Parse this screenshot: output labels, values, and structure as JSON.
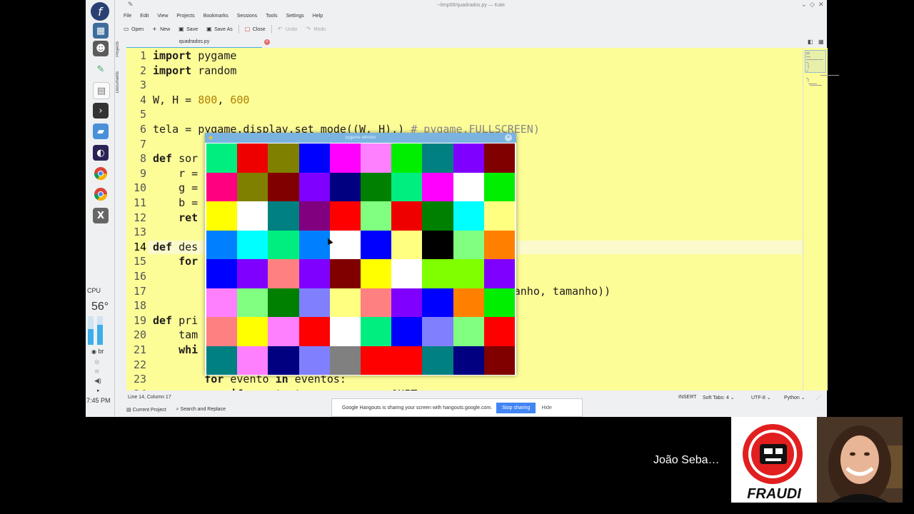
{
  "panel": {
    "fedora_glyph": "f",
    "cpu_label": "CPU",
    "cpu_temp": "56°",
    "keyboard_layout": "br",
    "clock": "7:45 PM",
    "dock_icons": [
      "fedora-icon",
      "console-icon",
      "gimp-icon",
      "document-icon",
      "terminal-icon",
      "chat-icon",
      "eclipse-icon",
      "chrome-icon",
      "chrome-icon",
      "xournal-icon"
    ]
  },
  "kate": {
    "window_title": "~/tmp06/quadrados.py — Kate",
    "menu": [
      "File",
      "Edit",
      "View",
      "Projects",
      "Bookmarks",
      "Sessions",
      "Tools",
      "Settings",
      "Help"
    ],
    "toolbar": {
      "open": "Open",
      "new": "New",
      "save": "Save",
      "save_as": "Save As",
      "close": "Close",
      "undo": "Undo",
      "redo": "Redo"
    },
    "tab_name": "quadrados.py",
    "sidebar_tabs": [
      "Projects",
      "Documents"
    ],
    "code_lines": [
      "import pygame",
      "import random",
      "",
      "W, H = 800, 600",
      "",
      "tela = pygame.display.set_mode((W, H),) # pygame.FULLSCREEN)",
      "",
      "def sor",
      "    r =",
      "    g =",
      "    b =",
      "    ret",
      "",
      "def des",
      "    for",
      "",
      "                                                  y, tamanho, tamanho))",
      "",
      "def pri",
      "    tam",
      "    whi",
      "",
      "        for evento in eventos:",
      "            if evento.type == pygame.QUIT:"
    ],
    "status": {
      "position": "Line 14, Column 17",
      "mode": "INSERT",
      "indent": "Soft Tabs: 4",
      "encoding": "UTF-8",
      "language": "Python"
    },
    "bottom_tabs": [
      "Current Project",
      "Search and Replace"
    ]
  },
  "pygame": {
    "title": "pygame window",
    "colors": [
      "#00ee80",
      "#ee0000",
      "#808000",
      "#0000ff",
      "#ff00ff",
      "#ff80ff",
      "#00ee00",
      "#008080",
      "#8000ff",
      "#800000",
      "#ff0080",
      "#808000",
      "#800000",
      "#8000ff",
      "#000080",
      "#008000",
      "#00ee80",
      "#ff00ff",
      "#ffffff",
      "#00ee00",
      "#ffff00",
      "#ffffff",
      "#008080",
      "#800080",
      "#ff0000",
      "#80ff80",
      "#ee0000",
      "#008000",
      "#00ffff",
      "#ffff80",
      "#0080ff",
      "#00ffff",
      "#00ee80",
      "#0080ff",
      "#ffffff",
      "#0000ff",
      "#ffff80",
      "#000000",
      "#80ff80",
      "#ff8000",
      "#0000ff",
      "#8000ff",
      "#ff8080",
      "#8000ff",
      "#800000",
      "#ffff00",
      "#ffffff",
      "#80ff00",
      "#80ff00",
      "#8000ff",
      "#ff80ff",
      "#80ff80",
      "#008000",
      "#8080ff",
      "#ffff80",
      "#ff8080",
      "#8000ff",
      "#0000ff",
      "#ff8000",
      "#00ee00",
      "#ff8080",
      "#ffff00",
      "#ff80ff",
      "#ff0000",
      "#ffffff",
      "#00ee80",
      "#0000ff",
      "#8080ff",
      "#80ff80",
      "#ff0000",
      "#008080",
      "#ff80ff",
      "#000080",
      "#8080ff",
      "#808080",
      "#ff0000",
      "#ff0000",
      "#008080",
      "#000080",
      "#800000"
    ]
  },
  "hangouts": {
    "message": "Google Hangouts is sharing your screen with hangouts.google.com.",
    "stop": "Stop sharing",
    "hide": "Hide"
  },
  "call": {
    "name": "João Seba…",
    "logo_text": "FRAUDI"
  }
}
